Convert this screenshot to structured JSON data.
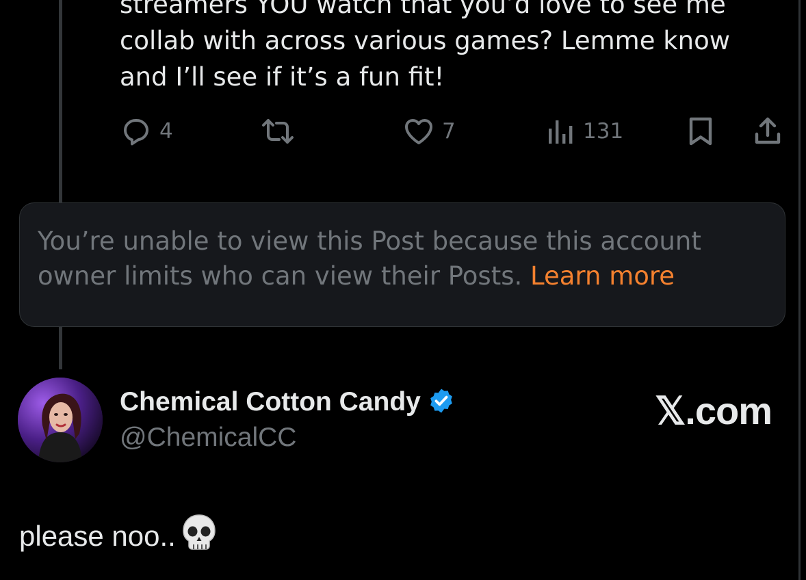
{
  "post": {
    "text": "streamers YOU watch that you’d love to see me\ncollab with across various games? Lemme know\nand I’ll see if it’s a fun fit!",
    "actions": {
      "reply_count": "4",
      "repost_count": "",
      "like_count": "7",
      "views_count": "131"
    }
  },
  "restricted_notice": {
    "message": "You’re unable to view this Post because this account owner limits who can view their Posts.",
    "link_label": "Learn more",
    "link_color": "#f4812f"
  },
  "reply": {
    "author_name": "Chemical Cotton Candy",
    "author_handle": "@ChemicalCC",
    "verified": true,
    "text": "please noo..",
    "emoji": "skull"
  },
  "brand": {
    "label": "𝕏.com"
  },
  "colors": {
    "background": "#000000",
    "text_primary": "#e7e9ea",
    "text_secondary": "#71767b",
    "verified_badge": "#1d9bf0",
    "card_background": "#16181c"
  },
  "icons": [
    "reply-icon",
    "repost-icon",
    "like-icon",
    "views-icon",
    "bookmark-icon",
    "share-icon",
    "verified-badge-icon",
    "skull-emoji-icon"
  ]
}
